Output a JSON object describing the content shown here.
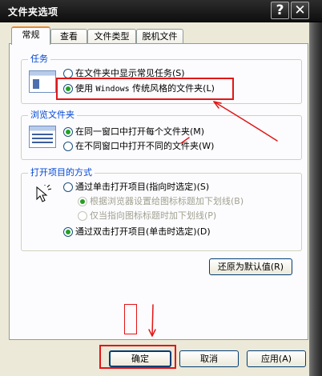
{
  "window": {
    "title": "文件夹选项",
    "help_glyph": "?",
    "close_glyph": "✕"
  },
  "tabs": [
    {
      "label": "常规",
      "active": true
    },
    {
      "label": "查看",
      "active": false
    },
    {
      "label": "文件类型",
      "active": false
    },
    {
      "label": "脱机文件",
      "active": false
    }
  ],
  "tasks": {
    "title": "任务",
    "icon": "folder-tasks-icon",
    "options": [
      {
        "label": "在文件夹中显示常见任务",
        "key": "(S)",
        "checked": false
      },
      {
        "label_a": "使用 ",
        "label_mono": "Windows",
        "label_b": " 传统风格的文件夹",
        "key": "(L)",
        "checked": true
      }
    ]
  },
  "browse": {
    "title": "浏览文件夹",
    "icon": "folder-window-icon",
    "options": [
      {
        "label": "在同一窗口中打开每个文件夹",
        "key": "(M)",
        "checked": true
      },
      {
        "label": "在不同窗口中打开不同的文件夹",
        "key": "(W)",
        "checked": false
      }
    ]
  },
  "click": {
    "title": "打开项目的方式",
    "icon": "pointer-click-icon",
    "options": [
      {
        "label": "通过单击打开项目(指向时选定)",
        "key": "(S)",
        "checked": false,
        "disabled": false
      },
      {
        "label": "根据浏览器设置给图标标题加下划线",
        "key": "(B)",
        "checked": true,
        "disabled": true
      },
      {
        "label": "仅当指向图标标题时加下划线",
        "key": "(P)",
        "checked": false,
        "disabled": true
      },
      {
        "label": "通过双击打开项目(单击时选定)",
        "key": "(D)",
        "checked": true,
        "disabled": false
      }
    ]
  },
  "buttons": {
    "restore_defaults": "还原为默认值(R)",
    "ok": "确定",
    "cancel": "取消",
    "apply": "应用(A)"
  },
  "annotation_color": "#e21616"
}
